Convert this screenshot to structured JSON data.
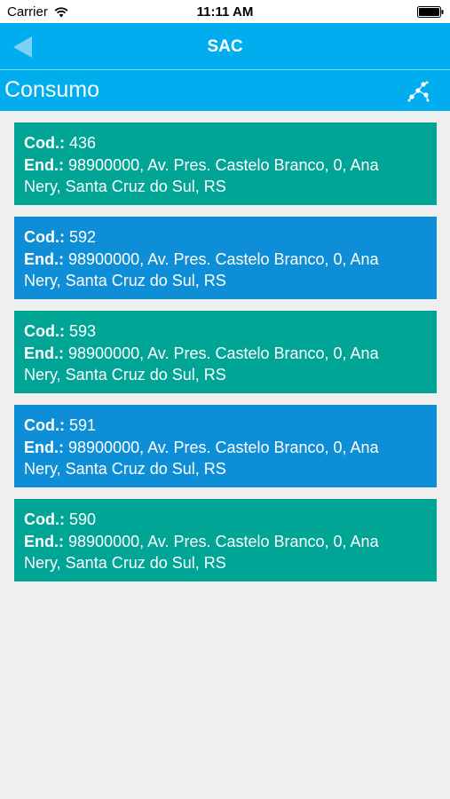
{
  "status_bar": {
    "carrier": "Carrier",
    "time": "11:11 AM"
  },
  "nav": {
    "title": "SAC"
  },
  "section": {
    "title": "Consumo"
  },
  "labels": {
    "cod": "Cod.:",
    "end": "End.:"
  },
  "colors": {
    "header_bg": "#00aeef",
    "card_teal": "#00a596",
    "card_blue": "#0e8ed6",
    "page_bg": "#efefef"
  },
  "cards": [
    {
      "cod": "436",
      "end_line1": "98900000, Av. Pres. Castelo Branco, 0, Ana",
      "end_line2": "Nery, Santa Cruz do Sul, RS",
      "color": "teal"
    },
    {
      "cod": "592",
      "end_line1": "98900000, Av. Pres. Castelo Branco, 0, Ana",
      "end_line2": "Nery, Santa Cruz do Sul, RS",
      "color": "blue"
    },
    {
      "cod": "593",
      "end_line1": "98900000, Av. Pres. Castelo Branco, 0, Ana",
      "end_line2": "Nery, Santa Cruz do Sul, RS",
      "color": "teal"
    },
    {
      "cod": "591",
      "end_line1": "98900000, Av. Pres. Castelo Branco, 0, Ana",
      "end_line2": "Nery, Santa Cruz do Sul, RS",
      "color": "blue"
    },
    {
      "cod": "590",
      "end_line1": "98900000, Av. Pres. Castelo Branco, 0, Ana",
      "end_line2": "Nery, Santa Cruz do Sul, RS",
      "color": "teal"
    }
  ]
}
